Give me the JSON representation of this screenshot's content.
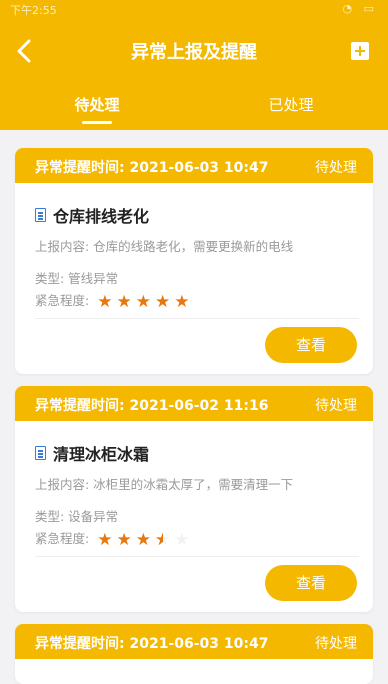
{
  "statusbar": {
    "time": "下午2:55",
    "icons": "◔ ▭"
  },
  "header": {
    "title": "异常上报及提醒"
  },
  "tabs": [
    {
      "label": "待处理",
      "active": true
    },
    {
      "label": "已处理",
      "active": false
    }
  ],
  "cards": [
    {
      "time": "异常提醒时间: 2021-06-03 10:47",
      "status": "待处理",
      "title": "仓库排线老化",
      "content": "上报内容: 仓库的线路老化，需要更换新的电线",
      "type": "类型: 管线异常",
      "urgency_label": "紧急程度:",
      "urgency_value": 5,
      "button": "查看"
    },
    {
      "time": "异常提醒时间: 2021-06-02 11:16",
      "status": "待处理",
      "title": "清理冰柜冰霜",
      "content": "上报内容: 冰柜里的冰霜太厚了，需要清理一下",
      "type": "类型: 设备异常",
      "urgency_label": "紧急程度:",
      "urgency_value": 3.5,
      "button": "查看"
    },
    {
      "time": "异常提醒时间: 2021-06-03 10:47",
      "status": "待处理"
    }
  ],
  "colors": {
    "accent": "#f5b800",
    "star": "#e8770f"
  }
}
